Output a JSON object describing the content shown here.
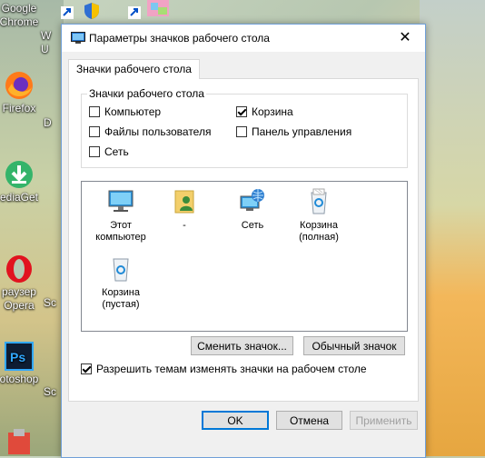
{
  "desktop": {
    "icons": [
      {
        "label_line1": "Google",
        "label_line2": "Chrome"
      },
      {
        "label_line1": "Firefox",
        "label_line2": ""
      },
      {
        "label_line1": "ediaGet",
        "label_line2": ""
      },
      {
        "label_line1": "раузер",
        "label_line2": "Opera"
      },
      {
        "label_line1": "otoshop",
        "label_line2": ""
      }
    ],
    "partial_labels": [
      "W",
      "U",
      "D",
      "Sc",
      "Sc"
    ]
  },
  "dialog": {
    "title": "Параметры значков рабочего стола",
    "close_glyph": "✕",
    "tab_label": "Значки рабочего стола",
    "group_title": "Значки рабочего стола",
    "checkboxes": [
      {
        "label": "Компьютер",
        "checked": false
      },
      {
        "label": "Корзина",
        "checked": true
      },
      {
        "label": "Файлы пользователя",
        "checked": false
      },
      {
        "label": "Панель управления",
        "checked": false
      },
      {
        "label": "Сеть",
        "checked": false
      }
    ],
    "icon_items": [
      {
        "line1": "Этот",
        "line2": "компьютер",
        "icon": "computer-icon"
      },
      {
        "line1": "-",
        "line2": "",
        "icon": "user-folder-icon"
      },
      {
        "line1": "Сеть",
        "line2": "",
        "icon": "network-icon"
      },
      {
        "line1": "Корзина",
        "line2": "(полная)",
        "icon": "recycle-bin-full-icon"
      },
      {
        "line1": "Корзина",
        "line2": "(пустая)",
        "icon": "recycle-bin-empty-icon"
      }
    ],
    "change_icon_button": "Сменить значок...",
    "default_icon_button": "Обычный значок",
    "allow_themes": {
      "label": "Разрешить темам изменять значки на рабочем столе",
      "checked": true
    },
    "ok_button": "OK",
    "cancel_button": "Отмена",
    "apply_button": "Применить"
  }
}
